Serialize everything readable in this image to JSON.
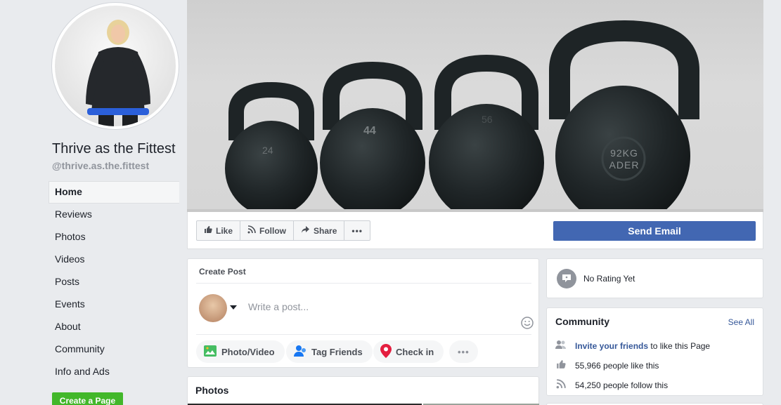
{
  "profile": {
    "name": "Thrive as the Fittest",
    "handle": "@thrive.as.the.fittest"
  },
  "nav": {
    "items": [
      "Home",
      "Reviews",
      "Photos",
      "Videos",
      "Posts",
      "Events",
      "About",
      "Community",
      "Info and Ads"
    ],
    "active": "Home",
    "create_page": "Create a Page"
  },
  "cover": {
    "kettlebells": [
      "24",
      "44",
      "56",
      "92KG ADER"
    ]
  },
  "actions": {
    "like": "Like",
    "follow": "Follow",
    "share": "Share",
    "more": "•••",
    "send_email": "Send Email"
  },
  "create_post": {
    "title": "Create Post",
    "placeholder": "Write a post...",
    "photo_video": "Photo/Video",
    "tag_friends": "Tag Friends",
    "check_in": "Check in",
    "more": "•••"
  },
  "photos": {
    "title": "Photos"
  },
  "rating": {
    "text": "No Rating Yet"
  },
  "community": {
    "title": "Community",
    "see_all": "See All",
    "invite_link": "Invite your friends",
    "invite_rest": "to like this Page",
    "likes": "55,966 people like this",
    "follows": "54,250 people follow this"
  },
  "colors": {
    "accent": "#4267b2",
    "link": "#365899",
    "create_green": "#42b72a",
    "background": "#e9ebee"
  }
}
